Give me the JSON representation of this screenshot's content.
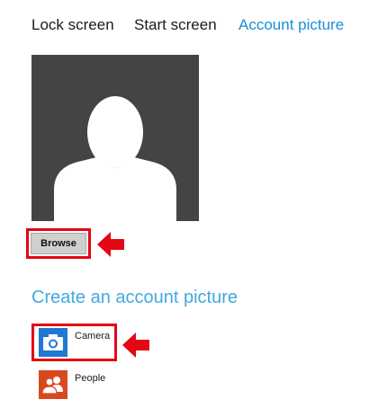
{
  "tabs": [
    {
      "label": "Lock screen",
      "active": false
    },
    {
      "label": "Start screen",
      "active": false
    },
    {
      "label": "Account picture",
      "active": true
    }
  ],
  "avatar": {
    "icon": "default-user-silhouette"
  },
  "browse_label": "Browse",
  "create_section": {
    "title": "Create an account picture",
    "apps": [
      {
        "label": "Camera",
        "icon": "camera-icon"
      },
      {
        "label": "People",
        "icon": "people-icon"
      }
    ]
  },
  "colors": {
    "accent": "#1b8fd6",
    "section_title": "#41a9e1",
    "highlight": "#e30613",
    "camera_tile": "#1f78d1",
    "people_tile": "#d9491f",
    "avatar_bg": "#444444"
  }
}
